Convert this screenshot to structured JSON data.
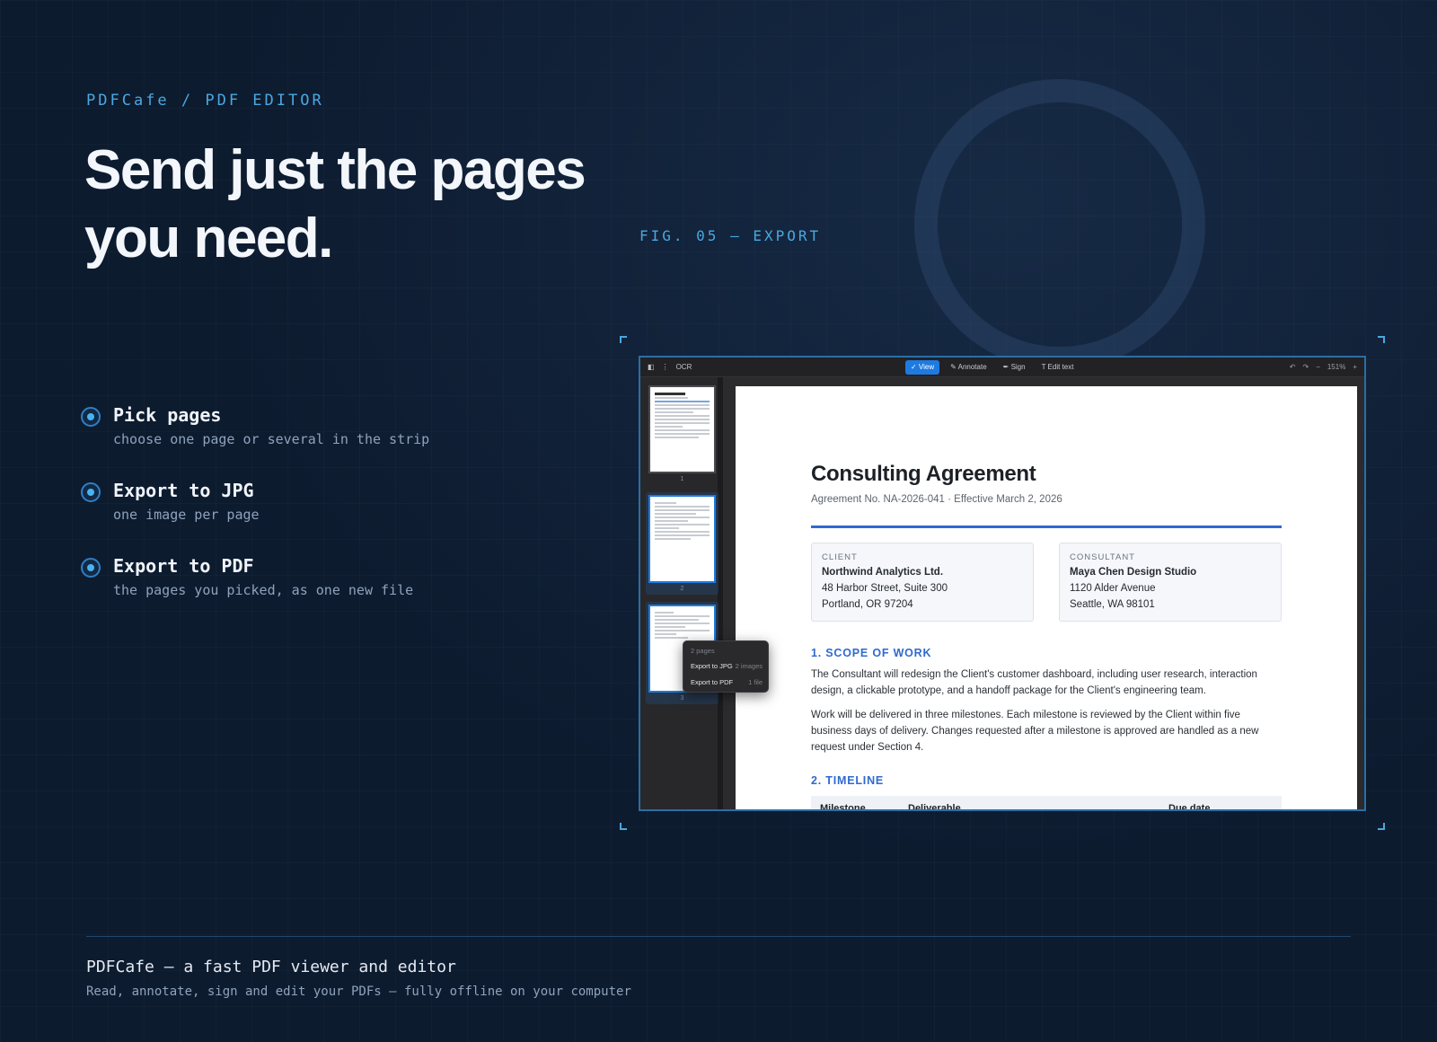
{
  "eyebrow": "PDFCafe / PDF EDITOR",
  "headline": "Send just the pages you need.",
  "figure_label": "FIG. 05 — EXPORT",
  "features": [
    {
      "title": "Pick pages",
      "subtitle": "choose one page or several in the strip"
    },
    {
      "title": "Export to JPG",
      "subtitle": "one image per page"
    },
    {
      "title": "Export to PDF",
      "subtitle": "the pages you picked, as one new file"
    }
  ],
  "app": {
    "toolbar": {
      "ocr_label": "OCR",
      "modes": [
        {
          "label": "✓ View",
          "active": true
        },
        {
          "label": "✎ Annotate",
          "active": false
        },
        {
          "label": "✒ Sign",
          "active": false
        },
        {
          "label": "T Edit text",
          "active": false
        }
      ],
      "zoom": "151%"
    },
    "thumbnails": [
      {
        "number": "1",
        "selected": false
      },
      {
        "number": "2",
        "selected": true
      },
      {
        "number": "3",
        "selected": true
      }
    ],
    "context_menu": {
      "header": "2 pages",
      "items": [
        {
          "label": "Export to JPG",
          "hint": "2 images"
        },
        {
          "label": "Export to PDF",
          "hint": "1 file"
        }
      ]
    },
    "document": {
      "title": "Consulting Agreement",
      "meta": "Agreement No. NA-2026-041 · Effective March 2, 2026",
      "client": {
        "label": "CLIENT",
        "name": "Northwind Analytics Ltd.",
        "address1": "48 Harbor Street, Suite 300",
        "address2": "Portland, OR 97204"
      },
      "consultant": {
        "label": "CONSULTANT",
        "name": "Maya Chen Design Studio",
        "address1": "1120 Alder Avenue",
        "address2": "Seattle, WA 98101"
      },
      "section1": {
        "heading": "1. SCOPE OF WORK",
        "p1": "The Consultant will redesign the Client's customer dashboard, including user research, interaction design, a clickable prototype, and a handoff package for the Client's engineering team.",
        "p2": "Work will be delivered in three milestones. Each milestone is reviewed by the Client within five business days of delivery. Changes requested after a milestone is approved are handled as a new request under Section 4."
      },
      "section2": {
        "heading": "2. TIMELINE",
        "columns": [
          "Milestone",
          "Deliverable",
          "Due date"
        ]
      }
    }
  },
  "footer": {
    "title": "PDFCafe — a fast PDF viewer and editor",
    "subtitle": "Read, annotate, sign and edit your PDFs — fully offline on your computer"
  }
}
